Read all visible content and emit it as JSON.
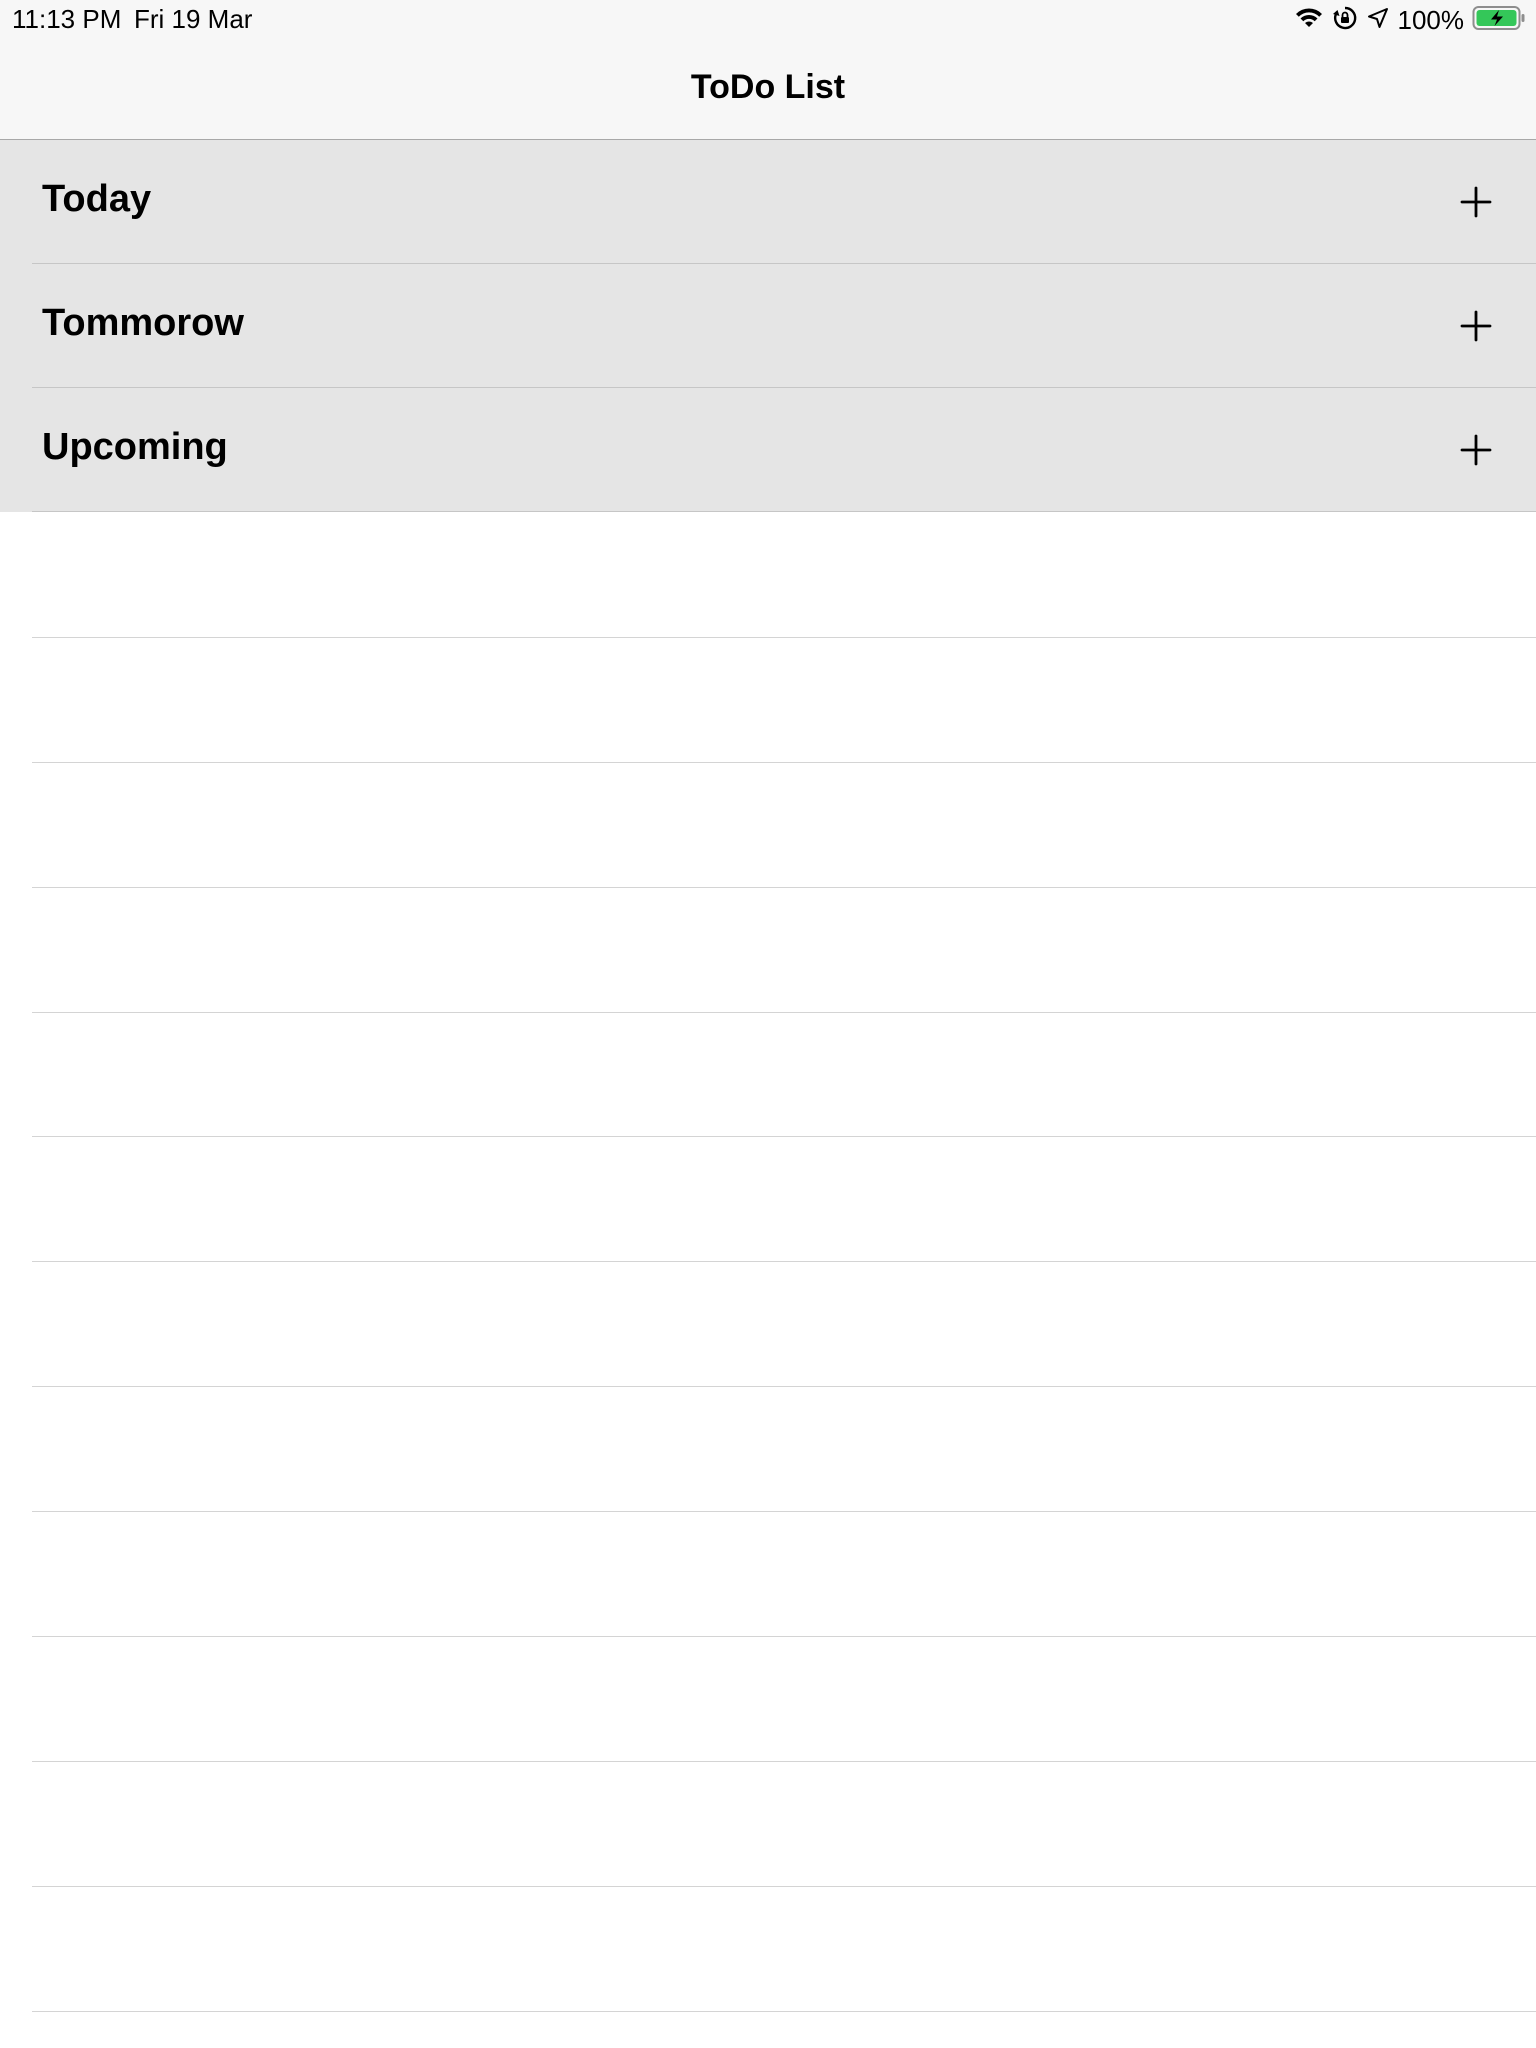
{
  "status_bar": {
    "time": "11:13 PM",
    "date": "Fri 19 Mar",
    "battery_percent": "100%",
    "icons": [
      "wifi-icon",
      "orientation-lock-icon",
      "location-icon",
      "battery-charging-icon"
    ],
    "battery_color": "#34c759"
  },
  "nav": {
    "title": "ToDo List"
  },
  "sections": [
    {
      "title": "Today",
      "action_icon": "plus-icon"
    },
    {
      "title": "Tommorow",
      "action_icon": "plus-icon"
    },
    {
      "title": "Upcoming",
      "action_icon": "plus-icon"
    }
  ],
  "colors": {
    "section_background": "#e5e5e5",
    "bar_background": "#f7f7f7",
    "text": "#000000"
  }
}
